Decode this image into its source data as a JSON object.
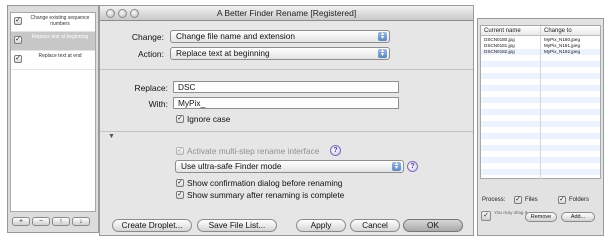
{
  "window": {
    "title": "A Better Finder Rename [Registered]"
  },
  "steps": {
    "items": [
      {
        "label": "Change existing sequence numbers",
        "checked": true,
        "selected": false
      },
      {
        "label": "Replace text at beginning",
        "checked": true,
        "selected": true
      },
      {
        "label": "Replace text at end",
        "checked": true,
        "selected": false
      }
    ],
    "tools": [
      "+",
      "−",
      "↑",
      "↓"
    ]
  },
  "form": {
    "change_label": "Change:",
    "change_value": "Change file name and extension",
    "action_label": "Action:",
    "action_value": "Replace text at beginning",
    "replace_label": "Replace:",
    "replace_value": "DSC",
    "with_label": "With:",
    "with_value": "MyPix_",
    "ignore_case_label": "Ignore case",
    "ignore_case_checked": true
  },
  "options": {
    "multistep_label": "Activate multi-step rename interface",
    "safe_mode_value": "Use ultra-safe Finder mode",
    "confirm_label": "Show confirmation dialog before renaming",
    "summary_label": "Show summary after renaming is complete"
  },
  "buttons": {
    "create_droplet": "Create Droplet...",
    "save_file_list": "Save File List...",
    "apply": "Apply",
    "cancel": "Cancel",
    "ok": "OK"
  },
  "preview": {
    "columns": [
      "Current name",
      "Change to"
    ],
    "rows": [
      [
        "DSCN0180.jpg",
        "MyPix_N180.jpeg"
      ],
      [
        "DSCN0181.jpg",
        "MyPix_N181.jpeg"
      ],
      [
        "DSCN0182.jpg",
        "MyPix_N182.jpeg"
      ]
    ]
  },
  "process": {
    "label": "Process:",
    "files_label": "Files",
    "folders_label": "Folders",
    "drag_hint": "You may drag &",
    "remove_label": "Remove",
    "add_label": "Add..."
  },
  "colors": {
    "selection": "#c7c7c7",
    "help_accent": "#7c6bb3",
    "popup_arrow": "#5d86bf"
  }
}
